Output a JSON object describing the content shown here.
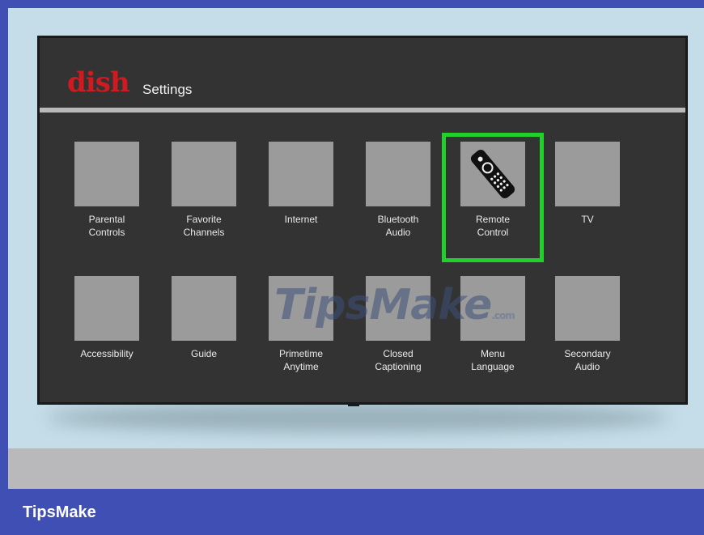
{
  "header": {
    "logo_text": "dish",
    "title": "Settings"
  },
  "row1": [
    {
      "label": "Parental\nControls",
      "icon": "blank-square"
    },
    {
      "label": "Favorite\nChannels",
      "icon": "blank-square"
    },
    {
      "label": "Internet",
      "icon": "blank-square"
    },
    {
      "label": "Bluetooth\nAudio",
      "icon": "blank-square"
    },
    {
      "label": "Remote\nControl",
      "icon": "remote-control-icon",
      "selected": true
    },
    {
      "label": "TV",
      "icon": "blank-square"
    }
  ],
  "row2": [
    {
      "label": "Accessibility",
      "icon": "blank-square"
    },
    {
      "label": "Guide",
      "icon": "blank-square"
    },
    {
      "label": "Primetime\nAnytime",
      "icon": "blank-square"
    },
    {
      "label": "Closed\nCaptioning",
      "icon": "blank-square"
    },
    {
      "label": "Menu\nLanguage",
      "icon": "blank-square"
    },
    {
      "label": "Secondary\nAudio",
      "icon": "blank-square"
    }
  ],
  "watermark": {
    "text": "TipsMake",
    "suffix": ".com"
  },
  "footer": {
    "brand": "TipsMake"
  },
  "colors": {
    "brand_blue": "#3f4fb3",
    "dish_red": "#d11a1f",
    "highlight_green": "#22d02c",
    "tv_body": "#333333",
    "tile_gray": "#9b9b9b"
  }
}
